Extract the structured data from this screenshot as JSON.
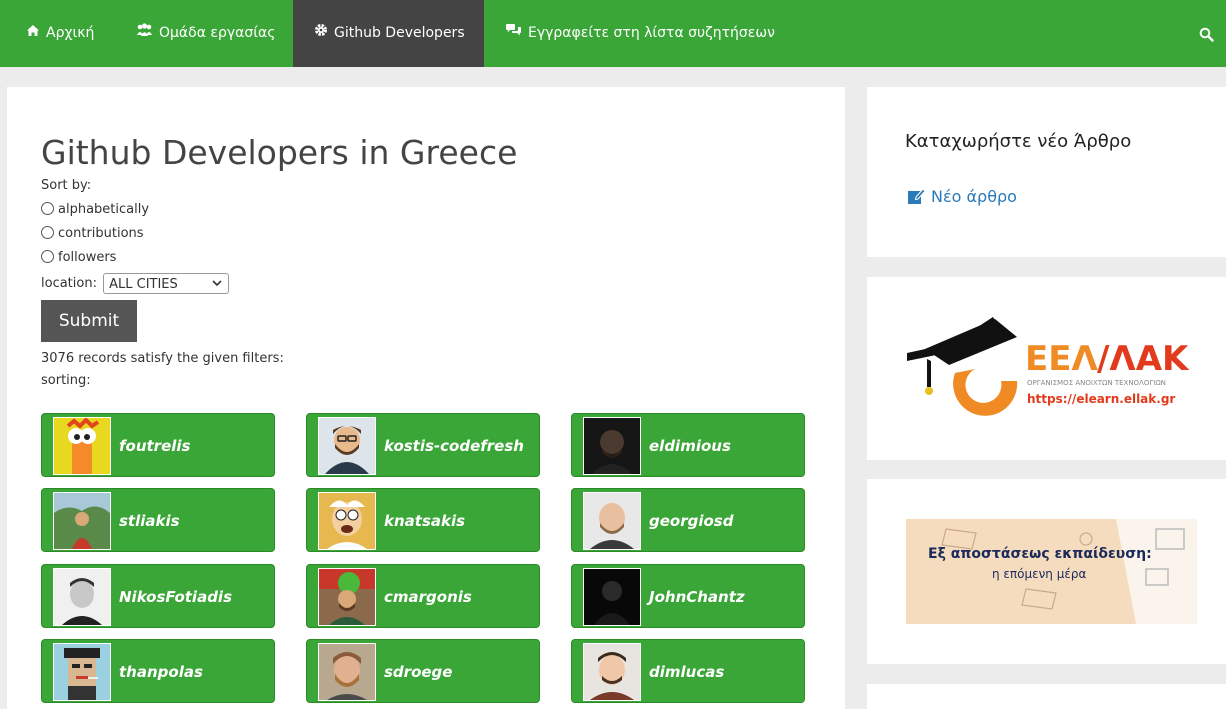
{
  "nav": {
    "items": [
      {
        "label": "Αρχική",
        "icon": "home-icon"
      },
      {
        "label": "Ομάδα εργασίας",
        "icon": "team-icon"
      },
      {
        "label": "Github Developers",
        "icon": "gear-icon"
      },
      {
        "label": "Εγγραφείτε στη λίστα συζητήσεων",
        "icon": "comments-icon"
      }
    ],
    "active": "Github Developers"
  },
  "main": {
    "title": "Github Developers in Greece",
    "sort_label": "Sort by:",
    "sort_options": [
      "alphabetically",
      "contributions",
      "followers"
    ],
    "location_label": "location:",
    "location_value": "ALL CITIES",
    "submit_label": "Submit",
    "records_text": "3076 records satisfy the given filters:",
    "sorting_label": "sorting:"
  },
  "developers": [
    {
      "username": "foutrelis"
    },
    {
      "username": "kostis-codefresh"
    },
    {
      "username": "eldimious"
    },
    {
      "username": "stliakis"
    },
    {
      "username": "knatsakis"
    },
    {
      "username": "georgiosd"
    },
    {
      "username": "NikosFotiadis"
    },
    {
      "username": "cmargonis"
    },
    {
      "username": "JohnChantz"
    },
    {
      "username": "thanpolas"
    },
    {
      "username": "sdroege"
    },
    {
      "username": "dimlucas"
    }
  ],
  "sidebar": {
    "new_article_title": "Καταχωρήστε νέο Άρθρο",
    "new_article_link": "Νέο άρθρο",
    "eellak_logo": {
      "name": "ΕΕΛ/ΛΑΚ",
      "subtitle": "ΟΡΓΑΝΙΣΜΟΣ ΑΝΟΙΧΤΩΝ ΤΕΧΝΟΛΟΓΙΩΝ",
      "url": "https://elearn.ellak.gr"
    },
    "banner": {
      "line1": "Εξ αποστάσεως εκπαίδευση:",
      "line2": "η επόμενη μέρα"
    }
  },
  "colors": {
    "nav_green": "#3aa637",
    "active_nav": "#444444",
    "link_blue": "#2a7ab8",
    "logo_orange": "#f08a24",
    "logo_red": "#e23a1c"
  }
}
